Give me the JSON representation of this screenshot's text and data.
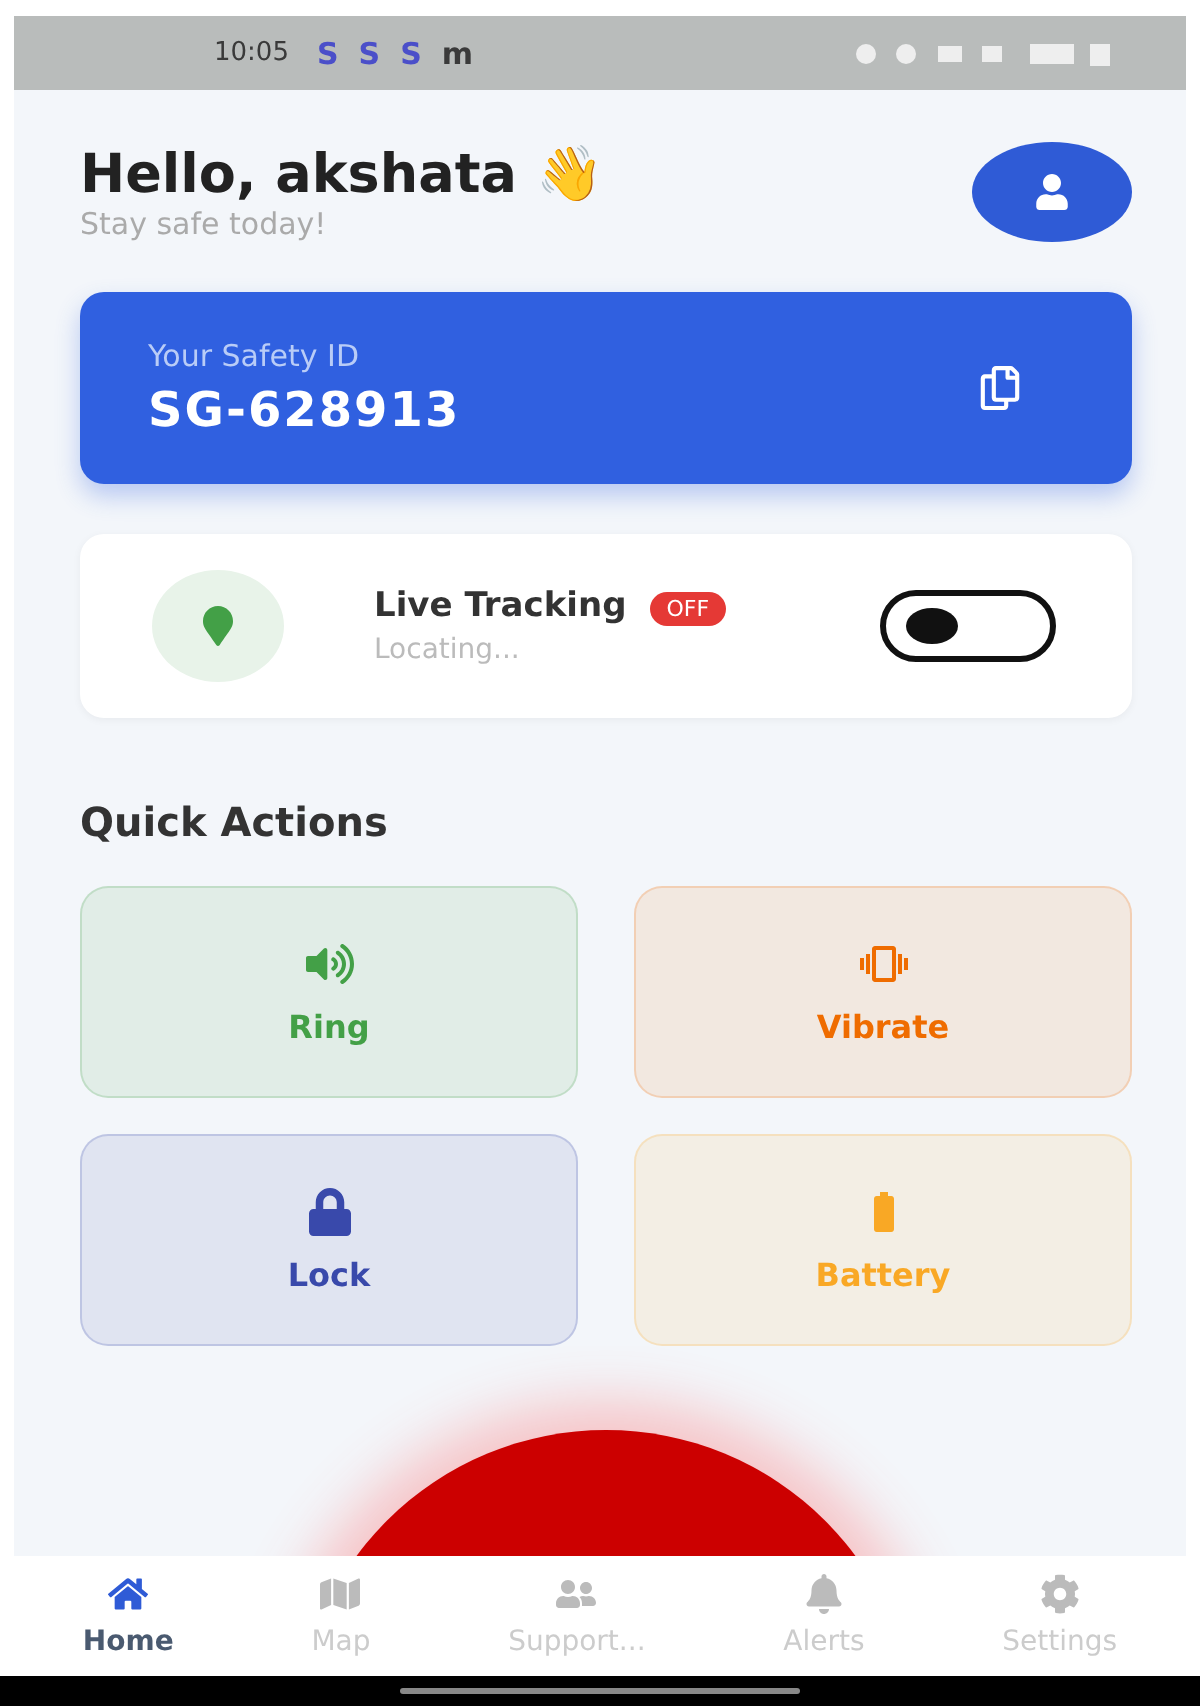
{
  "status_bar": {
    "time": "10:05",
    "notifications": [
      "S",
      "S",
      "S",
      "m"
    ]
  },
  "header": {
    "greeting": "Hello, akshata",
    "emoji": "👋",
    "subtitle": "Stay safe today!"
  },
  "safety_card": {
    "label": "Your Safety ID",
    "id": "SG-628913"
  },
  "tracking": {
    "title": "Live Tracking",
    "badge": "OFF",
    "status": "Locating...",
    "on": false
  },
  "quick_actions": {
    "title": "Quick Actions",
    "items": [
      {
        "kind": "ring",
        "label": "Ring",
        "color": "#43a047"
      },
      {
        "kind": "vibrate",
        "label": "Vibrate",
        "color": "#ef6c00"
      },
      {
        "kind": "lock",
        "label": "Lock",
        "color": "#3949ab"
      },
      {
        "kind": "battery",
        "label": "Battery",
        "color": "#f9a825"
      }
    ]
  },
  "nav": [
    {
      "kind": "home",
      "label": "Home",
      "selected": true
    },
    {
      "kind": "map",
      "label": "Map",
      "selected": false
    },
    {
      "kind": "support",
      "label": "Support...",
      "selected": false
    },
    {
      "kind": "alerts",
      "label": "Alerts",
      "selected": false
    },
    {
      "kind": "settings",
      "label": "Settings",
      "selected": false
    }
  ]
}
